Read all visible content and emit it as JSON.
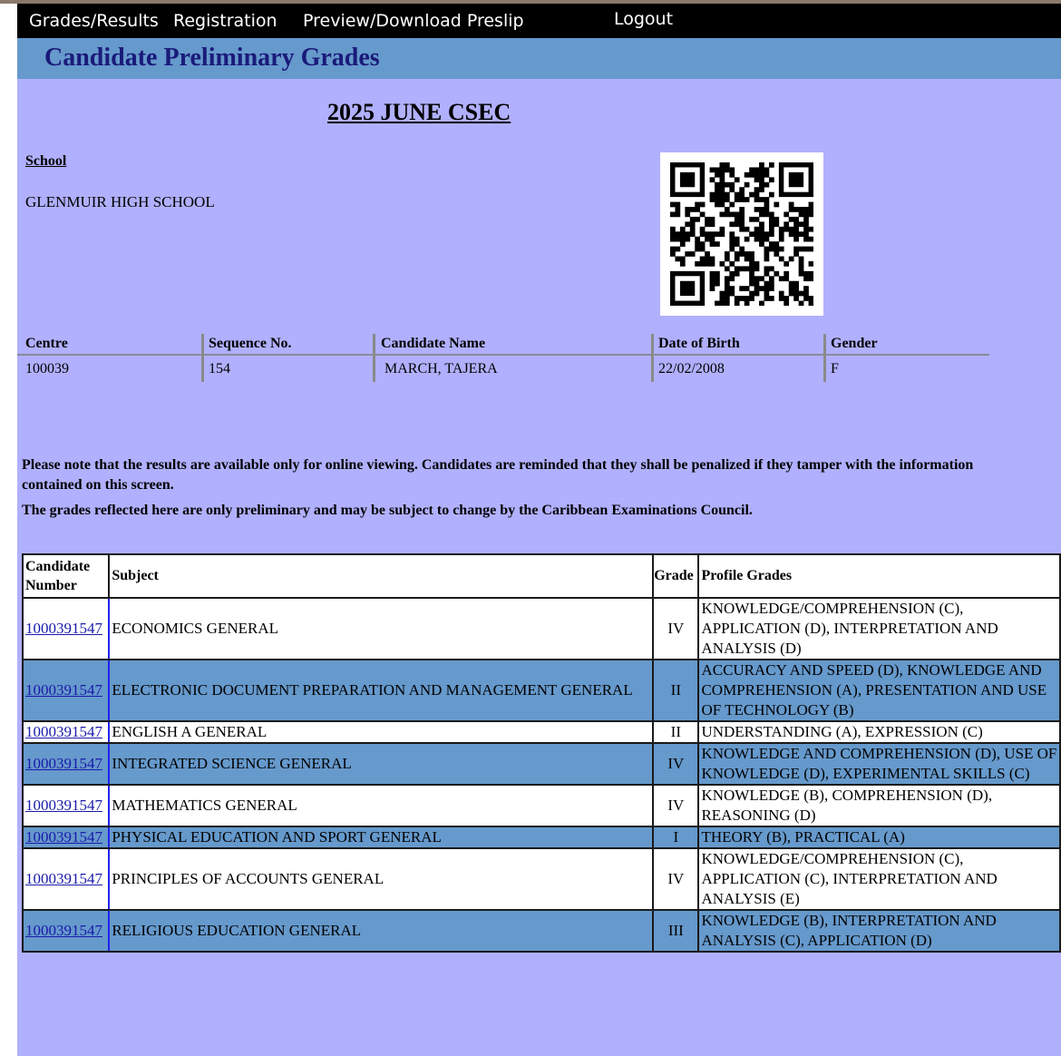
{
  "nav": {
    "grades_results": "Grades/Results",
    "registration": "Registration",
    "preview_download": "Preview/Download Preslip",
    "logout": "Logout"
  },
  "page_title": "Candidate Preliminary Grades",
  "session": "2025 JUNE CSEC",
  "school": {
    "label": "School",
    "name": "GLENMUIR HIGH SCHOOL"
  },
  "candidate_info": {
    "headers": [
      "Centre",
      "Sequence No.",
      "Candidate Name",
      "Date of Birth",
      "Gender"
    ],
    "values": [
      "100039",
      "154",
      "MARCH, TAJERA",
      "22/02/2008",
      "F"
    ]
  },
  "notices": [
    "Please note that the results are available only for online viewing. Candidates are reminded that they shall be penalized if they tamper with the information contained on this screen.",
    "The grades reflected here are only preliminary and may be subject to change by the Caribbean Examinations Council."
  ],
  "results_table": {
    "headers": [
      "Candidate Number",
      "Subject",
      "Grade",
      "Profile Grades"
    ],
    "rows": [
      {
        "candidate_number": "1000391547",
        "subject": "ECONOMICS GENERAL",
        "grade": "IV",
        "profile": "KNOWLEDGE/COMPREHENSION (C), APPLICATION (D), INTERPRETATION AND ANALYSIS (D)"
      },
      {
        "candidate_number": "1000391547",
        "subject": "ELECTRONIC DOCUMENT PREPARATION AND MANAGEMENT GENERAL",
        "grade": "II",
        "profile": "ACCURACY AND SPEED (D), KNOWLEDGE AND COMPREHENSION (A), PRESENTATION AND USE OF TECHNOLOGY (B)"
      },
      {
        "candidate_number": "1000391547",
        "subject": "ENGLISH A GENERAL",
        "grade": "II",
        "profile": "UNDERSTANDING (A), EXPRESSION (C)"
      },
      {
        "candidate_number": "1000391547",
        "subject": "INTEGRATED SCIENCE GENERAL",
        "grade": "IV",
        "profile": "KNOWLEDGE AND COMPREHENSION (D), USE OF KNOWLEDGE (D), EXPERIMENTAL SKILLS (C)"
      },
      {
        "candidate_number": "1000391547",
        "subject": "MATHEMATICS GENERAL",
        "grade": "IV",
        "profile": "KNOWLEDGE (B), COMPREHENSION (D), REASONING (D)"
      },
      {
        "candidate_number": "1000391547",
        "subject": "PHYSICAL EDUCATION AND SPORT GENERAL",
        "grade": "I",
        "profile": "THEORY (B), PRACTICAL (A)"
      },
      {
        "candidate_number": "1000391547",
        "subject": "PRINCIPLES OF ACCOUNTS GENERAL",
        "grade": "IV",
        "profile": "KNOWLEDGE/COMPREHENSION (C), APPLICATION (C), INTERPRETATION AND ANALYSIS (E)"
      },
      {
        "candidate_number": "1000391547",
        "subject": "RELIGIOUS EDUCATION GENERAL",
        "grade": "III",
        "profile": "KNOWLEDGE (B), INTERPRETATION AND ANALYSIS (C), APPLICATION (D)"
      }
    ]
  },
  "colors": {
    "page_background": "#b0b0fe",
    "banner": "#6699cc",
    "title_text": "#1a1a7a",
    "alt_row": "#6699cc",
    "link": "#1a1aaa"
  }
}
